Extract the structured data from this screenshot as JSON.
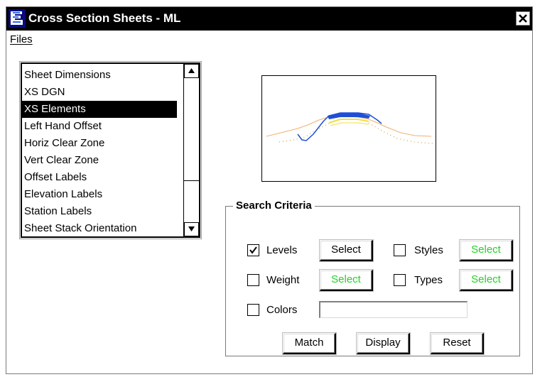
{
  "window": {
    "title": "Cross Section Sheets - ML"
  },
  "menu": {
    "files_label": "Files"
  },
  "sheet_list": {
    "items": [
      "Sheet Dimensions",
      "XS DGN",
      "XS Elements",
      "Left Hand Offset",
      "Horiz Clear Zone",
      "Vert Clear Zone",
      "Offset Labels",
      "Elevation Labels",
      "Station Labels",
      "Sheet Stack Orientation"
    ],
    "selected": "XS Elements"
  },
  "search_criteria": {
    "title": "Search Criteria",
    "levels": {
      "label": "Levels",
      "checked": true,
      "button": "Select"
    },
    "styles": {
      "label": "Styles",
      "checked": false,
      "button": "Select"
    },
    "weight": {
      "label": "Weight",
      "checked": false,
      "button": "Select"
    },
    "types": {
      "label": "Types",
      "checked": false,
      "button": "Select"
    },
    "colors": {
      "label": "Colors",
      "checked": false,
      "value": ""
    },
    "match_button": "Match",
    "display_button": "Display",
    "reset_button": "Reset"
  },
  "colors": {
    "title_bar": "#000000",
    "selection": "#000000",
    "disabled_select_text": "#21d321",
    "preview_ground": "#f0b070",
    "preview_blue": "#1e4fd8",
    "preview_yellow": "#f0e040",
    "preview_dots": "#c8a050"
  }
}
